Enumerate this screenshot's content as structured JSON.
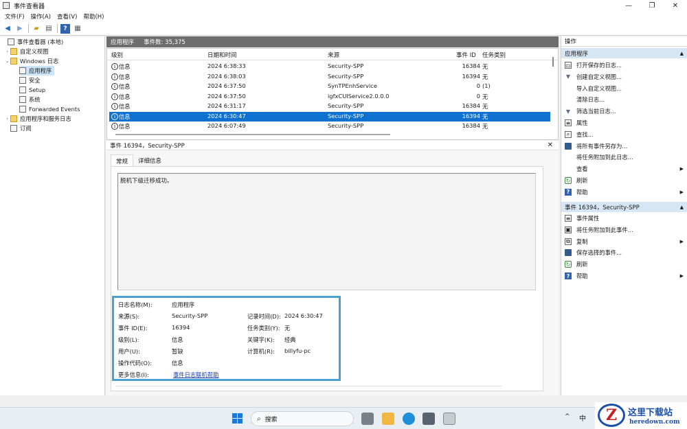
{
  "window": {
    "title": "事件查看器",
    "buttons": [
      "—",
      "❐",
      "✕"
    ]
  },
  "menu": [
    "文件(F)",
    "操作(A)",
    "查看(V)",
    "帮助(H)"
  ],
  "tree": [
    {
      "label": "事件查看器 (本地)",
      "depth": 0,
      "expander": ""
    },
    {
      "label": "自定义视图",
      "depth": 1,
      "expander": "›"
    },
    {
      "label": "Windows 日志",
      "depth": 1,
      "expander": "⌄"
    },
    {
      "label": "应用程序",
      "depth": 2,
      "expander": "",
      "selected": true
    },
    {
      "label": "安全",
      "depth": 2,
      "expander": ""
    },
    {
      "label": "Setup",
      "depth": 2,
      "expander": ""
    },
    {
      "label": "系统",
      "depth": 2,
      "expander": ""
    },
    {
      "label": "Forwarded Events",
      "depth": 2,
      "expander": ""
    },
    {
      "label": "应用程序和服务日志",
      "depth": 1,
      "expander": "›"
    },
    {
      "label": "订阅",
      "depth": 1,
      "expander": ""
    }
  ],
  "middle": {
    "header_title": "应用程序",
    "header_count": "事件数: 35,375",
    "columns": {
      "level": "级别",
      "datetime": "日期和时间",
      "source": "来源",
      "eventid": "事件 ID",
      "category": "任务类别"
    },
    "rows": [
      {
        "level": "信息",
        "datetime": "2024 6:38:33",
        "source": "Security-SPP",
        "eventid": "16384",
        "category": "无"
      },
      {
        "level": "信息",
        "datetime": "2024 6:38:03",
        "source": "Security-SPP",
        "eventid": "16394",
        "category": "无"
      },
      {
        "level": "信息",
        "datetime": "2024 6:37:50",
        "source": "SynTPEnhService",
        "eventid": "0",
        "category": "(1)"
      },
      {
        "level": "信息",
        "datetime": "2024 6:37:50",
        "source": "igfxCUIService2.0.0.0",
        "eventid": "0",
        "category": "无"
      },
      {
        "level": "信息",
        "datetime": "2024 6:31:17",
        "source": "Security-SPP",
        "eventid": "16384",
        "category": "无"
      },
      {
        "level": "信息",
        "datetime": "2024 6:30:47",
        "source": "Security-SPP",
        "eventid": "16394",
        "category": "无",
        "selected": true
      },
      {
        "level": "信息",
        "datetime": "2024 6:07:49",
        "source": "Security-SPP",
        "eventid": "16384",
        "category": "无"
      }
    ],
    "detail_title": "事件 16394，Security-SPP",
    "tabs": [
      "常规",
      "详细信息"
    ],
    "message": "脱机下级迁移成功。",
    "props": {
      "log_name_label": "日志名称(M):",
      "log_name": "应用程序",
      "source_label": "来源(S):",
      "source": "Security-SPP",
      "logged_label": "记录时间(D):",
      "logged": "2024 6:30:47",
      "eventid_label": "事件 ID(E):",
      "eventid": "16394",
      "task_label": "任务类别(Y):",
      "task": "无",
      "level_label": "级别(L):",
      "level": "信息",
      "keywords_label": "关键字(K):",
      "keywords": "经典",
      "user_label": "用户(U):",
      "user": "暂缺",
      "computer_label": "计算机(R):",
      "computer": "billyfu-pc",
      "opcode_label": "操作代码(O):",
      "opcode": "信息",
      "moreinfo_label": "更多信息(I):",
      "moreinfo_link": "事件日志联机帮助"
    }
  },
  "actions": {
    "title": "操作",
    "section1": "应用程序",
    "items1": [
      {
        "label": "打开保存的日志...",
        "icon": "folder-icon"
      },
      {
        "label": "创建自定义视图...",
        "icon": "funnel-icon"
      },
      {
        "label": "导入自定义视图...",
        "icon": ""
      },
      {
        "label": "清除日志...",
        "icon": ""
      },
      {
        "label": "筛选当前日志...",
        "icon": "funnel-icon"
      },
      {
        "label": "属性",
        "icon": "properties-icon"
      },
      {
        "label": "查找...",
        "icon": "find-icon"
      },
      {
        "label": "将所有事件另存为...",
        "icon": "save-icon"
      },
      {
        "label": "将任务附加到此日志...",
        "icon": ""
      },
      {
        "label": "查看",
        "icon": "",
        "submenu": true
      },
      {
        "label": "刷新",
        "icon": "refresh-icon"
      },
      {
        "label": "帮助",
        "icon": "help-icon",
        "submenu": true
      }
    ],
    "section2": "事件 16394，Security-SPP",
    "items2": [
      {
        "label": "事件属性",
        "icon": "properties-icon"
      },
      {
        "label": "将任务附加到此事件...",
        "icon": "task-icon"
      },
      {
        "label": "复制",
        "icon": "copy-icon",
        "submenu": true
      },
      {
        "label": "保存选择的事件...",
        "icon": "save-icon"
      },
      {
        "label": "刷新",
        "icon": "refresh-icon"
      },
      {
        "label": "帮助",
        "icon": "help-icon",
        "submenu": true
      }
    ]
  },
  "taskbar": {
    "search": "搜索",
    "ime": "中"
  },
  "watermark": {
    "brand": "这里下载站",
    "url": "heredown.com"
  }
}
